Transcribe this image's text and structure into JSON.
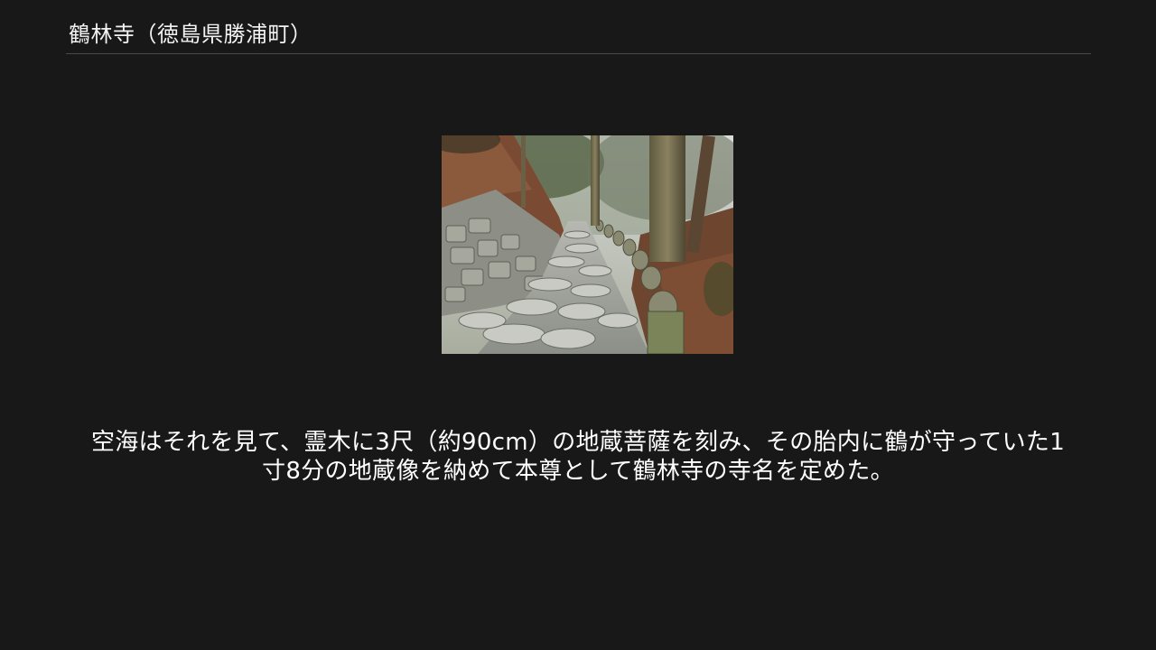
{
  "slide": {
    "title": "鶴林寺（徳島県勝浦町）",
    "caption_line1": "空海はそれを見て、霊木に3尺（約90cm）の地蔵菩薩を刻み、その胎内に鶴が守っていた1",
    "caption_line2": "寸8分の地蔵像を納めて本尊として鶴林寺の寺名を定めた。"
  },
  "colors": {
    "background": "#181818",
    "text": "#ffffff",
    "rule": "#4a4a4a"
  }
}
